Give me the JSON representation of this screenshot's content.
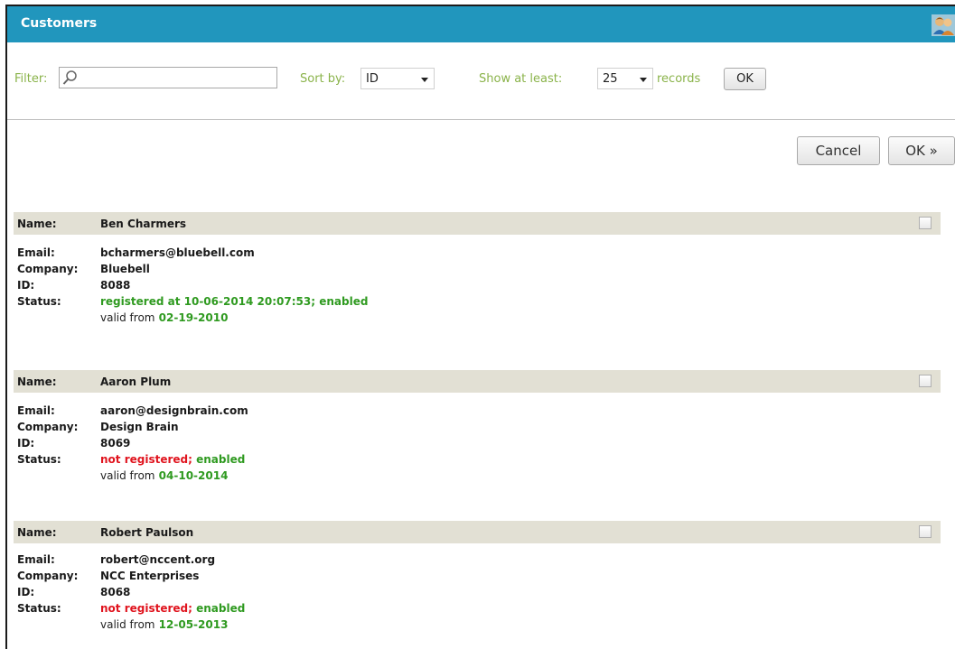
{
  "header": {
    "title": "Customers",
    "icon": "users-icon"
  },
  "filter": {
    "filter_label": "Filter:",
    "filter_value": "",
    "sort_label": "Sort by:",
    "sort_value": "ID",
    "show_label": "Show at least:",
    "show_value": "25",
    "records_label": "records",
    "ok_label": "OK"
  },
  "actions": {
    "cancel_label": "Cancel",
    "ok_label": "OK »"
  },
  "labels": {
    "name": "Name:",
    "email": "Email:",
    "company": "Company:",
    "id": "ID:",
    "status": "Status:",
    "valid_from": "valid from"
  },
  "customers": [
    {
      "name": "Ben Charmers",
      "email": "bcharmers@bluebell.com",
      "company": "Bluebell",
      "id": "8088",
      "registration": "registered at 10-06-2014 20:07:53",
      "separator": ";",
      "enabled": "enabled",
      "valid_from": "02-19-2010"
    },
    {
      "name": "Aaron Plum",
      "email": "aaron@designbrain.com",
      "company": "Design Brain",
      "id": "8069",
      "registration": "not registered",
      "separator": ";",
      "enabled": "enabled",
      "valid_from": "04-10-2014"
    },
    {
      "name": "Robert Paulson",
      "email": "robert@nccent.org",
      "company": "NCC Enterprises",
      "id": "8068",
      "registration": "not registered",
      "separator": ";",
      "enabled": "enabled",
      "valid_from": "12-05-2013"
    }
  ],
  "colors": {
    "header_bg": "#2196bd",
    "filter_label": "#8ab34a",
    "record_header_bg": "#e2e0d4",
    "registered": "#2f9a20",
    "not_registered": "#e0141e"
  }
}
